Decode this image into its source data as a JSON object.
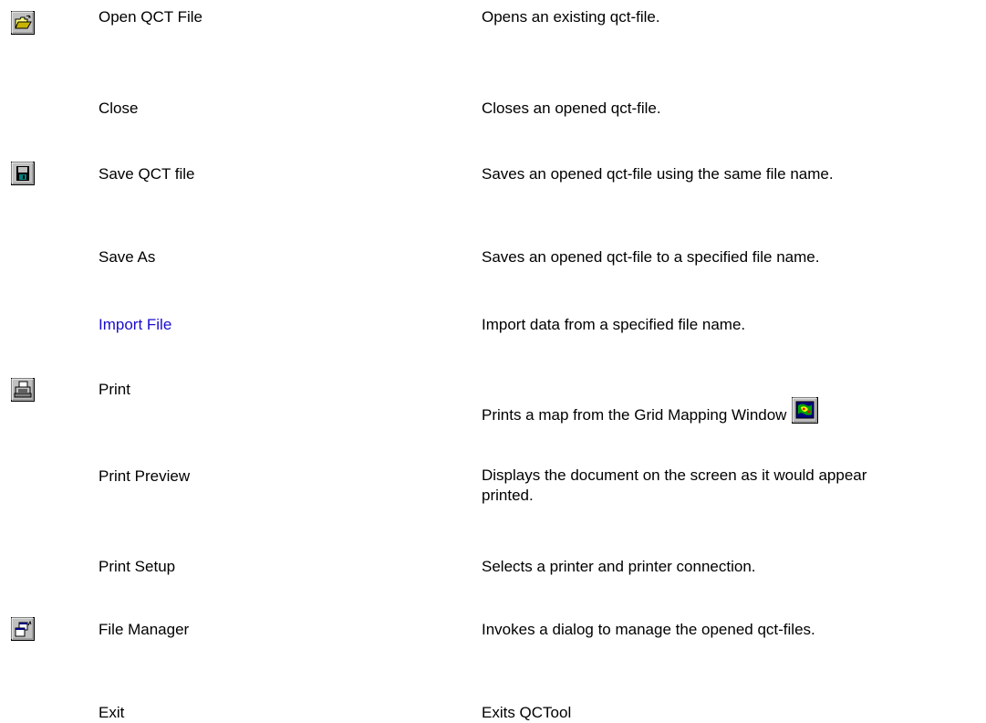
{
  "commands": [
    {
      "label": "Open QCT File",
      "description": "Opens an existing qct-file.",
      "icon": "open-folder-icon",
      "link": false
    },
    {
      "label": "Close",
      "description": "Closes an opened qct-file.",
      "icon": null,
      "link": false
    },
    {
      "label": "Save QCT file",
      "description": "Saves an opened qct-file using the same file name.",
      "icon": "floppy-disk-icon",
      "link": false
    },
    {
      "label": "Save As",
      "description": "Saves an opened qct-file to a specified file name.",
      "icon": null,
      "link": false
    },
    {
      "label": "Import File",
      "description": "Import data from a specified file name.",
      "icon": null,
      "link": true,
      "link_color": "#1a0dcc"
    },
    {
      "label": "Print",
      "description": "Prints a map from the Grid Mapping Window",
      "icon": "printer-icon",
      "inline_icon": "grid-map-icon",
      "link": false
    },
    {
      "label": "Print Preview",
      "description": "Displays the document on the screen as it would appear printed.",
      "icon": null,
      "link": false
    },
    {
      "label": "Print Setup",
      "description": "Selects a printer and printer connection.",
      "icon": null,
      "link": false
    },
    {
      "label": "File Manager",
      "description": "Invokes a dialog to manage the opened qct-files.",
      "icon": "file-manager-icon",
      "link": false
    },
    {
      "label": "Exit",
      "description": "Exits QCTool",
      "icon": null,
      "link": false
    }
  ]
}
